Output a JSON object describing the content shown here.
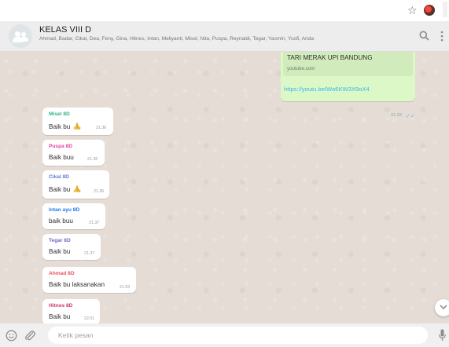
{
  "browser": {
    "star_icon": "star-outline-icon",
    "extension_icon": "extension-avatar-icon"
  },
  "header": {
    "group_name": "KELAS VIII D",
    "members": "Ahmad, Badar, Cikal, Dea, Feny, Gina, Hitnes, Intan, Meliyanti, Misel, Nita, Puspa, Reynaldi, Tegar, Yasmin, Yusfi, Anda",
    "icons": [
      "group-avatar-icon",
      "search-icon",
      "menu-dots-icon"
    ]
  },
  "outgoing": {
    "preview_title": "TARI MERAK UPI BANDUNG",
    "preview_domain": "youtube.com",
    "link": "https://youtu.be/Wo6KW3X9oX4",
    "time": "21.33",
    "status_icon": "double-check-icon",
    "status_color": "#4fc3f7"
  },
  "messages": [
    {
      "sender": "Misel 8D",
      "color": "#35b28d",
      "text": "Baik bu",
      "emoji": true,
      "time": "21.36"
    },
    {
      "sender": "Puspa 8D",
      "color": "#e542a3",
      "text": "Baik buu",
      "emoji": false,
      "time": "21.36"
    },
    {
      "sender": "Cikal 8D",
      "color": "#5f7fd4",
      "text": "Baik bu",
      "emoji": true,
      "time": "21.36"
    },
    {
      "sender": "Intan ayu 8D",
      "color": "#1f7aec",
      "text": "baik buu",
      "emoji": false,
      "time": "21.37"
    },
    {
      "sender": "Tegar 8D",
      "color": "#6b69c9",
      "text": "Baik bu",
      "emoji": false,
      "time": "21.37"
    },
    {
      "sender": "Ahmad 8D",
      "color": "#e9545a",
      "text": "Baik bu laksanakan",
      "emoji": false,
      "time": "21.53"
    },
    {
      "sender": "Hitnes 8D",
      "color": "#d6336c",
      "text": "Baik bu",
      "emoji": false,
      "time": "22.01"
    }
  ],
  "footer": {
    "placeholder": "Ketik pesan",
    "icons": [
      "emoji-icon",
      "attach-icon",
      "mic-icon"
    ]
  },
  "colors": {
    "chat_bg": "#e5ddd5",
    "outgoing_bg": "#dcf8c6",
    "link": "#34b7f1"
  }
}
